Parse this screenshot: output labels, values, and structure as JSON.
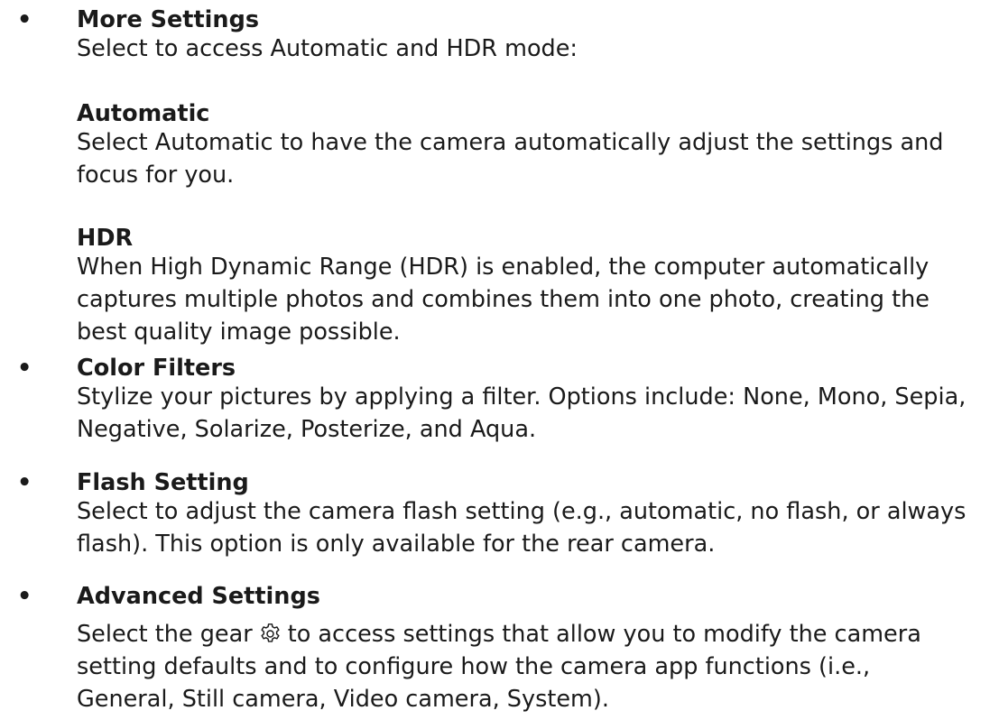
{
  "bullet_symbol": "•",
  "more_settings": {
    "heading": "More Settings",
    "intro": "Select to access Automatic and HDR mode:",
    "automatic": {
      "heading": "Automatic",
      "lines": [
        "Select Automatic to have the camera automatically adjust the settings and",
        "focus for you."
      ]
    },
    "hdr": {
      "heading": "HDR",
      "lines": [
        "When High Dynamic Range (HDR) is enabled, the computer automatically",
        "captures multiple photos and combines them into one photo, creating the",
        "best quality image possible."
      ]
    }
  },
  "color_filters": {
    "heading": "Color Filters",
    "lines": [
      "Stylize your pictures by applying a filter. Options include: None, Mono, Sepia,",
      "Negative, Solarize, Posterize, and Aqua."
    ]
  },
  "flash_setting": {
    "heading": "Flash Setting",
    "lines": [
      "Select to adjust the camera flash setting (e.g., automatic, no flash, or always",
      "flash). This option is only available for the rear camera."
    ]
  },
  "advanced_settings": {
    "heading": "Advanced Settings",
    "line1_before_icon": "Select the gear",
    "icon": "gear-icon",
    "line1_after_icon": "to access settings that allow you to modify the camera",
    "lines": [
      "setting defaults and to configure how the camera app functions (i.e.,",
      "General, Still camera, Video camera, System)."
    ]
  }
}
